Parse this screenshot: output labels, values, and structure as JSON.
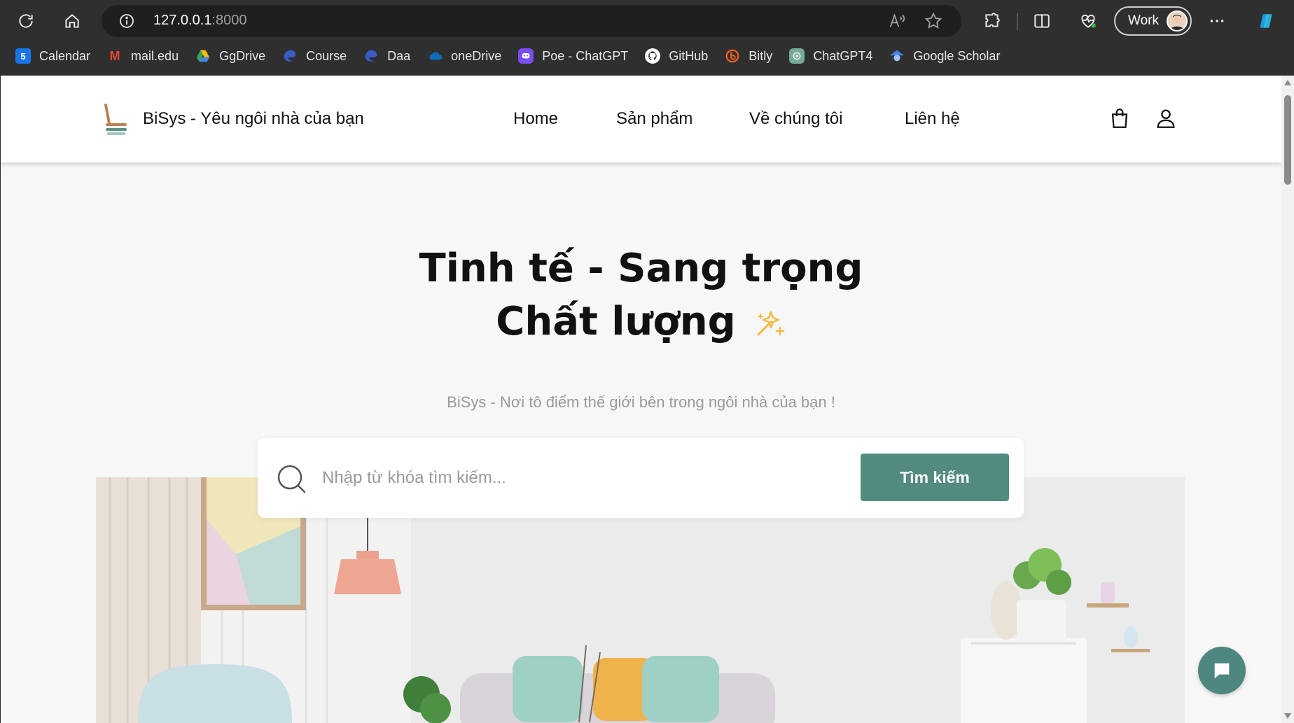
{
  "browser": {
    "url_host": "127.0.0.1",
    "url_port": ":8000",
    "profile_label": "Work",
    "bookmarks": [
      {
        "label": "Calendar",
        "icon": "calendar-icon",
        "color": "#1a73e8"
      },
      {
        "label": "mail.edu",
        "icon": "gmail-icon",
        "color": "#ea4335"
      },
      {
        "label": "GgDrive",
        "icon": "google-drive-icon",
        "color": "#34a853"
      },
      {
        "label": "Course",
        "icon": "edge-icon",
        "color": "#3a5cc7"
      },
      {
        "label": "Daa",
        "icon": "edge-icon",
        "color": "#3a5cc7"
      },
      {
        "label": "oneDrive",
        "icon": "onedrive-icon",
        "color": "#0f6cbd"
      },
      {
        "label": "Poe - ChatGPT",
        "icon": "poe-icon",
        "color": "#7b4cf0"
      },
      {
        "label": "GitHub",
        "icon": "github-icon",
        "color": "#ffffff"
      },
      {
        "label": "Bitly",
        "icon": "bitly-icon",
        "color": "#ee6123"
      },
      {
        "label": "ChatGPT4",
        "icon": "openai-icon",
        "color": "#74aa9c"
      },
      {
        "label": "Google Scholar",
        "icon": "scholar-icon",
        "color": "#4285f4"
      }
    ]
  },
  "site": {
    "brand": "BiSys - Yêu ngôi nhà của bạn",
    "nav": {
      "home": "Home",
      "products": "Sản phẩm",
      "about": "Về chúng tôi",
      "contact": "Liên hệ"
    },
    "hero": {
      "title_line1": "Tinh tế - Sang trọng",
      "title_line2": "Chất lượng",
      "subtitle": "BiSys - Nơi tô điểm thế giới bên trong ngôi nhà của bạn !"
    },
    "search": {
      "placeholder": "Nhập từ khóa tìm kiếm...",
      "button": "Tìm kiếm"
    },
    "colors": {
      "accent": "#548b81",
      "chat_button": "#4e8780",
      "sparkle": "#f5b942"
    }
  }
}
